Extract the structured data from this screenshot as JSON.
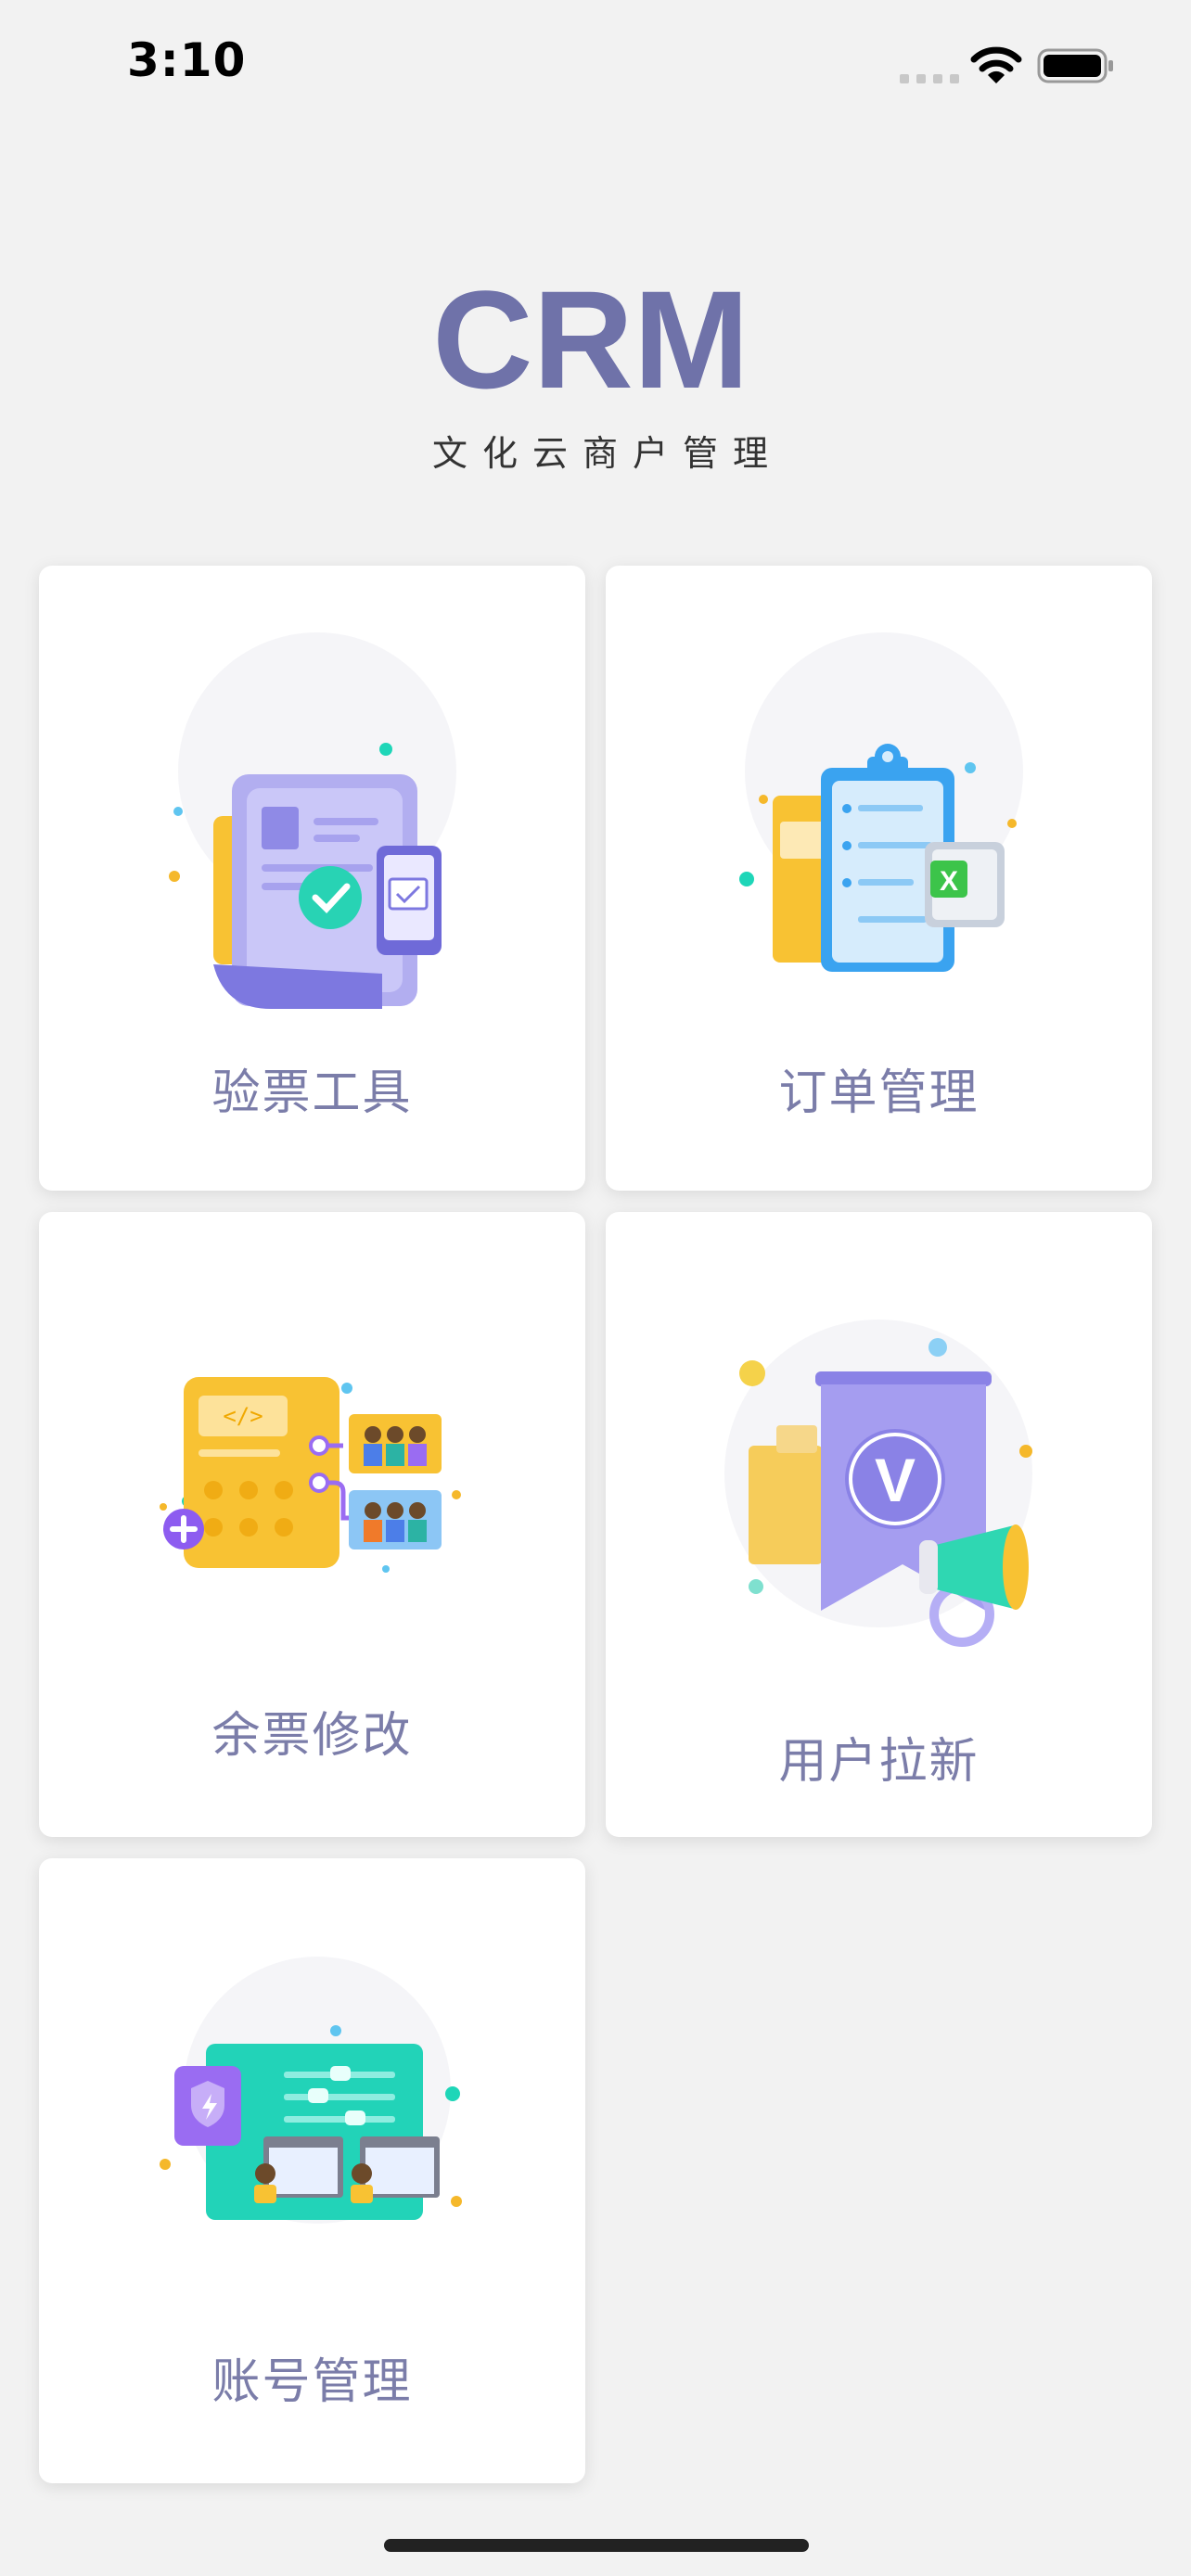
{
  "status_bar": {
    "time": "3:10"
  },
  "header": {
    "logo_text": "CRM",
    "subtitle": "文化云商户管理"
  },
  "menu": {
    "items": [
      {
        "label": "验票工具"
      },
      {
        "label": "订单管理"
      },
      {
        "label": "余票修改"
      },
      {
        "label": "用户拉新"
      },
      {
        "label": "账号管理"
      }
    ]
  },
  "colors": {
    "label": "#7b7da9",
    "logo": "#6f72a9",
    "background": "#f2f2f2"
  }
}
